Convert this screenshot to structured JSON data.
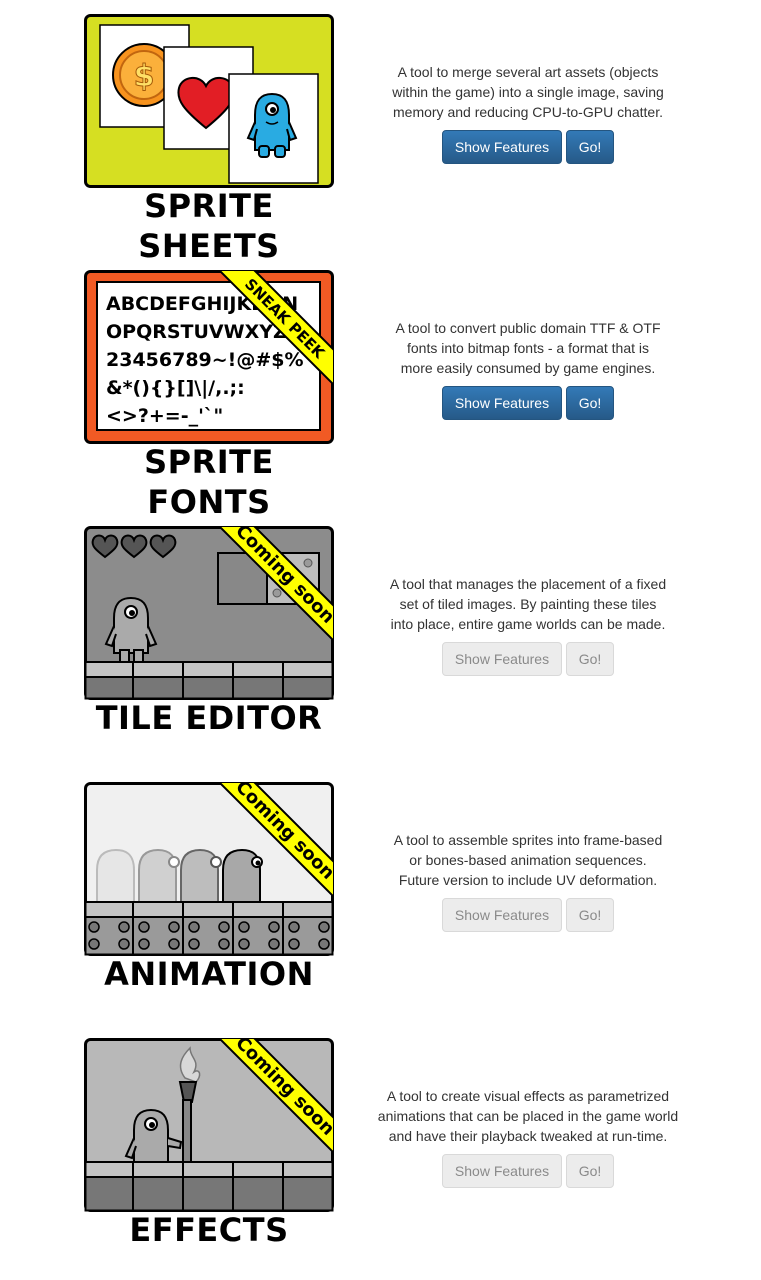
{
  "tools": [
    {
      "title": "SPRITE SHEETS",
      "description": "A tool to merge several art assets (objects\nwithin the game) into a single image, saving\nmemory and reducing CPU-to-GPU chatter.",
      "features_label": "Show Features",
      "go_label": "Go!",
      "enabled": true,
      "ribbon": "",
      "art": {
        "frame_color": "#d6df22",
        "coin_symbol": "$"
      }
    },
    {
      "title": "SPRITE FONTS",
      "description": "A tool to convert public domain TTF & OTF\nfonts into bitmap fonts - a format that is\nmore easily consumed by game engines.",
      "features_label": "Show Features",
      "go_label": "Go!",
      "enabled": true,
      "ribbon": "SNEAK PEEK",
      "art": {
        "frame_color": "#f15a24",
        "glyph_lines": [
          "ABCDEFGHIJKLMN",
          "OPQRSTUVWXYZ01",
          "23456789~!@#$%",
          "&*(){}[]\\|/,.;:",
          "<>?+=-_'`\""
        ]
      }
    },
    {
      "title": "TILE EDITOR",
      "description": "A tool that manages the placement of a fixed\nset of tiled images. By painting these tiles\ninto place, entire game worlds can be made.",
      "features_label": "Show Features",
      "go_label": "Go!",
      "enabled": false,
      "ribbon": "Coming soon",
      "art": {
        "frame_color": "#8c8c8c"
      }
    },
    {
      "title": "ANIMATION",
      "description": "A tool to assemble sprites into frame-based\nor bones-based animation sequences.\nFuture version to include UV deformation.",
      "features_label": "Show Features",
      "go_label": "Go!",
      "enabled": false,
      "ribbon": "Coming soon",
      "art": {
        "frame_color": "#f0f0f0"
      }
    },
    {
      "title": "EFFECTS",
      "description": "A tool to create visual effects as parametrized\nanimations that can be placed in the game world\nand have their playback tweaked at run-time.",
      "features_label": "Show Features",
      "go_label": "Go!",
      "enabled": false,
      "ribbon": "Coming soon",
      "art": {
        "frame_color": "#b8b8b8"
      }
    }
  ],
  "colors": {
    "button_active": "#2e6da4",
    "button_disabled": "#ececec",
    "ribbon": "#ffff00"
  }
}
